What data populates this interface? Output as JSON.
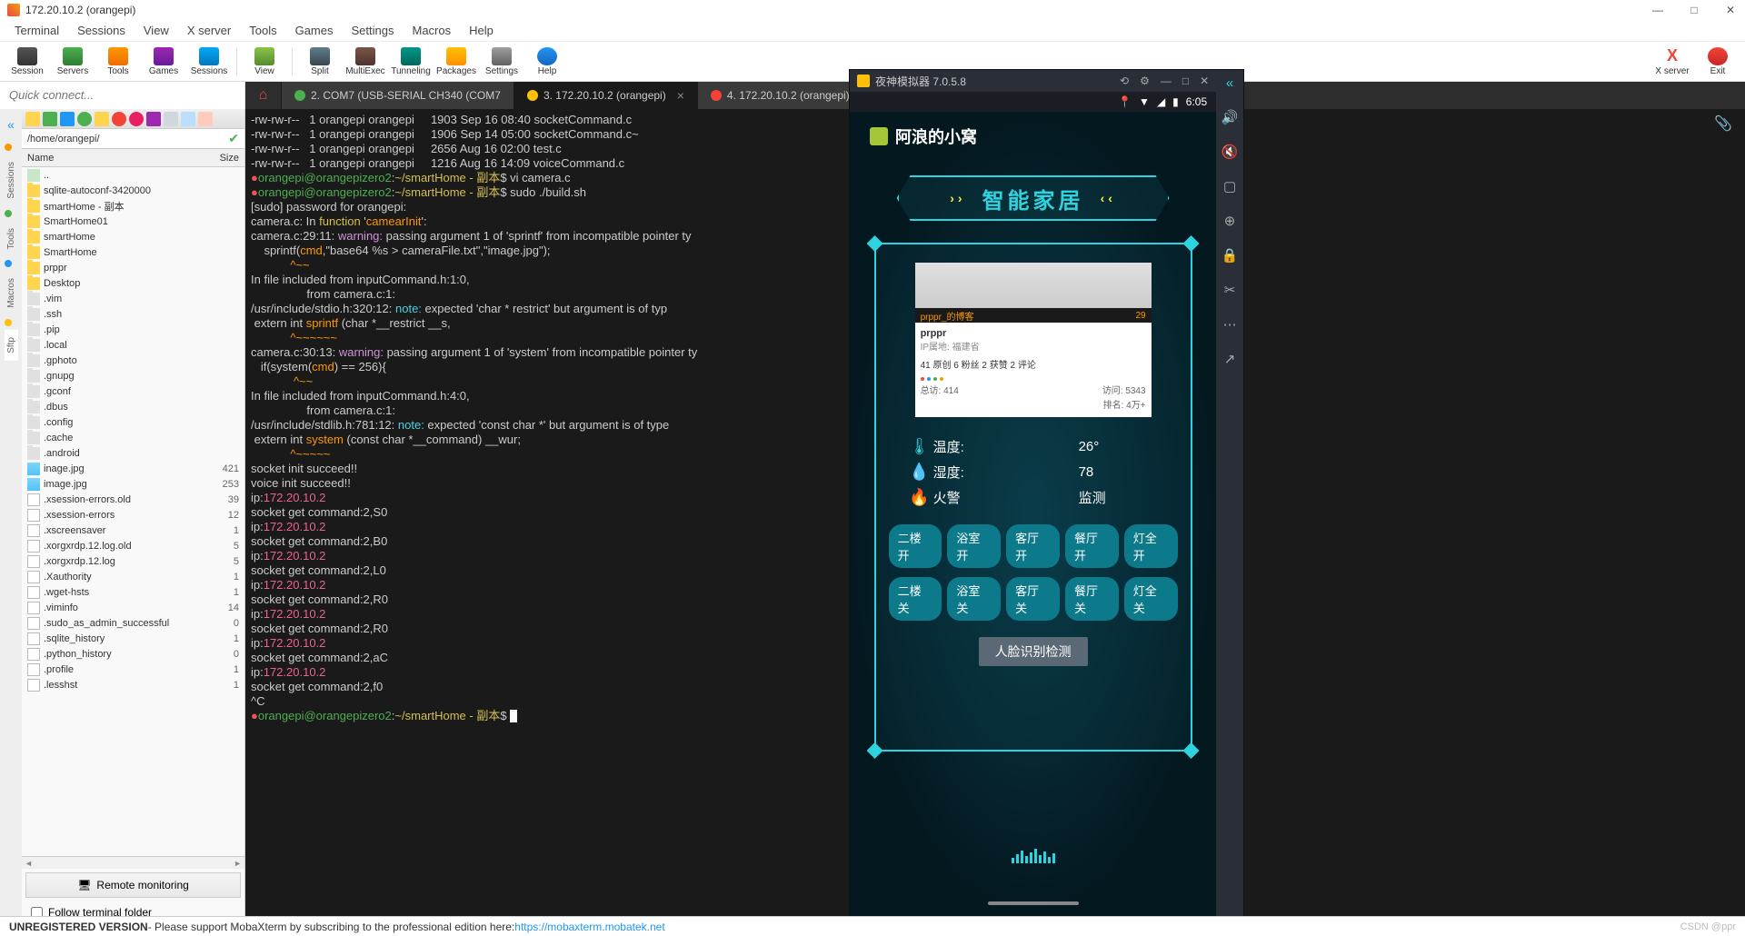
{
  "window": {
    "title": "172.20.10.2 (orangepi)"
  },
  "winControls": {
    "min": "—",
    "max": "□",
    "close": "✕"
  },
  "menu": [
    "Terminal",
    "Sessions",
    "View",
    "X server",
    "Tools",
    "Games",
    "Settings",
    "Macros",
    "Help"
  ],
  "toolbar": [
    {
      "label": "Session",
      "cls": "ti-session"
    },
    {
      "label": "Servers",
      "cls": "ti-servers"
    },
    {
      "label": "Tools",
      "cls": "ti-tools"
    },
    {
      "label": "Games",
      "cls": "ti-games"
    },
    {
      "label": "Sessions",
      "cls": "ti-sessions2"
    },
    {
      "label": "View",
      "cls": "ti-view"
    },
    {
      "label": "Split",
      "cls": "ti-split"
    },
    {
      "label": "MultiExec",
      "cls": "ti-multi"
    },
    {
      "label": "Tunneling",
      "cls": "ti-tunnel"
    },
    {
      "label": "Packages",
      "cls": "ti-pkg"
    },
    {
      "label": "Settings",
      "cls": "ti-settings"
    },
    {
      "label": "Help",
      "cls": "ti-help"
    }
  ],
  "toolbarRight": [
    {
      "label": "X server",
      "cls": "ti-xserver"
    },
    {
      "label": "Exit",
      "cls": "ti-exit"
    }
  ],
  "quickConnect": {
    "placeholder": "Quick connect..."
  },
  "tabs": [
    {
      "label": "2. COM7  (USB-SERIAL CH340 (COM7",
      "color": "#4caf50"
    },
    {
      "label": "3. 172.20.10.2 (orangepi)",
      "color": "#ffc107",
      "active": true,
      "closable": true
    },
    {
      "label": "4. 172.20.10.2 (orangepi)",
      "color": "#f44336"
    }
  ],
  "sideTabs": [
    {
      "label": "Sessions",
      "dot": "#ff9800"
    },
    {
      "label": "Tools",
      "dot": "#4caf50"
    },
    {
      "label": "Macros",
      "dot": "#2196f3"
    },
    {
      "label": "Sftp",
      "dot": "#ffc107",
      "active": true
    }
  ],
  "ftPath": "/home/orangepi/",
  "ftHeader": {
    "name": "Name",
    "size": "Size"
  },
  "ftItems": [
    {
      "name": "..",
      "type": "up",
      "size": ""
    },
    {
      "name": "sqlite-autoconf-3420000",
      "type": "folder",
      "size": ""
    },
    {
      "name": "smartHome - 副本",
      "type": "folder",
      "size": ""
    },
    {
      "name": "SmartHome01",
      "type": "folder",
      "size": ""
    },
    {
      "name": "smartHome",
      "type": "folder",
      "size": ""
    },
    {
      "name": "SmartHome",
      "type": "folder",
      "size": ""
    },
    {
      "name": "prppr",
      "type": "folder",
      "size": ""
    },
    {
      "name": "Desktop",
      "type": "folder",
      "size": ""
    },
    {
      "name": ".vim",
      "type": "hfolder",
      "size": ""
    },
    {
      "name": ".ssh",
      "type": "hfolder",
      "size": ""
    },
    {
      "name": ".pip",
      "type": "hfolder",
      "size": ""
    },
    {
      "name": ".local",
      "type": "hfolder",
      "size": ""
    },
    {
      "name": ".gphoto",
      "type": "hfolder",
      "size": ""
    },
    {
      "name": ".gnupg",
      "type": "hfolder",
      "size": ""
    },
    {
      "name": ".gconf",
      "type": "hfolder",
      "size": ""
    },
    {
      "name": ".dbus",
      "type": "hfolder",
      "size": ""
    },
    {
      "name": ".config",
      "type": "hfolder",
      "size": ""
    },
    {
      "name": ".cache",
      "type": "hfolder",
      "size": ""
    },
    {
      "name": ".android",
      "type": "hfolder",
      "size": ""
    },
    {
      "name": "inage.jpg",
      "type": "img",
      "size": "421"
    },
    {
      "name": "image.jpg",
      "type": "img",
      "size": "253"
    },
    {
      "name": ".xsession-errors.old",
      "type": "file",
      "size": "39"
    },
    {
      "name": ".xsession-errors",
      "type": "file",
      "size": "12"
    },
    {
      "name": ".xscreensaver",
      "type": "file",
      "size": "1"
    },
    {
      "name": ".xorgxrdp.12.log.old",
      "type": "file",
      "size": "5"
    },
    {
      "name": ".xorgxrdp.12.log",
      "type": "file",
      "size": "5"
    },
    {
      "name": ".Xauthority",
      "type": "file",
      "size": "1"
    },
    {
      "name": ".wget-hsts",
      "type": "file",
      "size": "1"
    },
    {
      "name": ".viminfo",
      "type": "file",
      "size": "14"
    },
    {
      "name": ".sudo_as_admin_successful",
      "type": "file",
      "size": "0"
    },
    {
      "name": ".sqlite_history",
      "type": "file",
      "size": "1"
    },
    {
      "name": ".python_history",
      "type": "file",
      "size": "0"
    },
    {
      "name": ".profile",
      "type": "file",
      "size": "1"
    },
    {
      "name": ".lesshst",
      "type": "file",
      "size": "1"
    }
  ],
  "ftRemote": "Remote monitoring",
  "ftFollow": "Follow terminal folder",
  "terminal": {
    "lines": [
      [
        {
          "t": "-rw-rw-r--   1 orangepi orangepi     1903 Sep 16 08:40 socketCommand.c"
        }
      ],
      [
        {
          "t": "-rw-rw-r--   1 orangepi orangepi     1906 Sep 14 05:00 socketCommand.c~"
        }
      ],
      [
        {
          "t": "-rw-rw-r--   1 orangepi orangepi     2656 Aug 16 02:00 test.c"
        }
      ],
      [
        {
          "t": "-rw-rw-r--   1 orangepi orangepi     1216 Aug 16 14:09 voiceCommand.c"
        }
      ],
      [
        {
          "cls": "t-prompt",
          "t": "●"
        },
        {
          "cls": "t-green",
          "t": "orangepi@orangepizero2"
        },
        {
          "t": ":"
        },
        {
          "cls": "t-yellow",
          "t": "~/smartHome - 副本"
        },
        {
          "t": "$ vi camera.c"
        }
      ],
      [
        {
          "cls": "t-prompt",
          "t": "●"
        },
        {
          "cls": "t-green",
          "t": "orangepi@orangepizero2"
        },
        {
          "t": ":"
        },
        {
          "cls": "t-yellow",
          "t": "~/smartHome - 副本"
        },
        {
          "t": "$ sudo ./build.sh"
        }
      ],
      [
        {
          "t": "[sudo] password for orangepi:"
        }
      ],
      [
        {
          "t": "camera.c: In "
        },
        {
          "cls": "t-yellow",
          "t": "function"
        },
        {
          "t": " '"
        },
        {
          "cls": "t-orange",
          "t": "camearInit"
        },
        {
          "t": "':"
        }
      ],
      [
        {
          "t": "camera.c:29:11: "
        },
        {
          "cls": "t-purple",
          "t": "warning:"
        },
        {
          "t": " passing argument 1 of 'sprintf' from incompatible pointer ty"
        }
      ],
      [
        {
          "t": "    sprintf("
        },
        {
          "cls": "t-orange",
          "t": "cmd"
        },
        {
          "t": ",\"base64 %s > cameraFile.txt\",\"image.jpg\");"
        }
      ],
      [
        {
          "cls": "t-orange",
          "t": "            ^~~"
        }
      ],
      [
        {
          "t": "In file included from inputCommand.h:1:0,"
        }
      ],
      [
        {
          "t": "                 from camera.c:1:"
        }
      ],
      [
        {
          "t": "/usr/include/stdio.h:320:12: "
        },
        {
          "cls": "t-cyan",
          "t": "note:"
        },
        {
          "t": " expected 'char * restrict' but argument is of typ"
        }
      ],
      [
        {
          "t": " extern int "
        },
        {
          "cls": "t-orange",
          "t": "sprintf"
        },
        {
          "t": " (char *__restrict __s,"
        }
      ],
      [
        {
          "cls": "t-orange",
          "t": "            ^~~~~~~"
        }
      ],
      [
        {
          "t": "camera.c:30:13: "
        },
        {
          "cls": "t-purple",
          "t": "warning:"
        },
        {
          "t": " passing argument 1 of 'system' from incompatible pointer ty"
        }
      ],
      [
        {
          "t": "   if(system("
        },
        {
          "cls": "t-orange",
          "t": "cmd"
        },
        {
          "t": ") == 256){"
        }
      ],
      [
        {
          "cls": "t-orange",
          "t": "             ^~~"
        }
      ],
      [
        {
          "t": "In file included from inputCommand.h:4:0,"
        }
      ],
      [
        {
          "t": "                 from camera.c:1:"
        }
      ],
      [
        {
          "t": "/usr/include/stdlib.h:781:12: "
        },
        {
          "cls": "t-cyan",
          "t": "note:"
        },
        {
          "t": " expected 'const char *' but argument is of type "
        }
      ],
      [
        {
          "t": " extern int "
        },
        {
          "cls": "t-orange",
          "t": "system"
        },
        {
          "t": " (const char *__command) __wur;"
        }
      ],
      [
        {
          "cls": "t-orange",
          "t": "            ^~~~~~"
        }
      ],
      [
        {
          "t": "socket init succeed!!"
        }
      ],
      [
        {
          "t": "voice init succeed!!"
        }
      ],
      [
        {
          "t": "ip:"
        },
        {
          "cls": "t-pink",
          "t": "172.20.10.2"
        }
      ],
      [
        {
          "t": "socket get command:2,S0"
        }
      ],
      [
        {
          "t": "ip:"
        },
        {
          "cls": "t-pink",
          "t": "172.20.10.2"
        }
      ],
      [
        {
          "t": "socket get command:2,B0"
        }
      ],
      [
        {
          "t": "ip:"
        },
        {
          "cls": "t-pink",
          "t": "172.20.10.2"
        }
      ],
      [
        {
          "t": "socket get command:2,L0"
        }
      ],
      [
        {
          "t": "ip:"
        },
        {
          "cls": "t-pink",
          "t": "172.20.10.2"
        }
      ],
      [
        {
          "t": "socket get command:2,R0"
        }
      ],
      [
        {
          "t": "ip:"
        },
        {
          "cls": "t-pink",
          "t": "172.20.10.2"
        }
      ],
      [
        {
          "t": "socket get command:2,R0"
        }
      ],
      [
        {
          "t": "ip:"
        },
        {
          "cls": "t-pink",
          "t": "172.20.10.2"
        }
      ],
      [
        {
          "t": "socket get command:2,aC"
        }
      ],
      [
        {
          "t": "ip:"
        },
        {
          "cls": "t-pink",
          "t": "172.20.10.2"
        }
      ],
      [
        {
          "t": "socket get command:2,f0"
        }
      ],
      [
        {
          "t": "^C"
        }
      ],
      [
        {
          "cls": "t-prompt",
          "t": "●"
        },
        {
          "cls": "t-green",
          "t": "orangepi@orangepizero2"
        },
        {
          "t": ":"
        },
        {
          "cls": "t-yellow",
          "t": "~/smartHome - 副本"
        },
        {
          "t": "$ "
        },
        {
          "cursor": true
        }
      ]
    ]
  },
  "nox": {
    "title": "夜神模拟器 7.0.5.8",
    "statusTime": "6:05",
    "appTitle": "阿浪的小窝",
    "banner": "智能家居",
    "card": {
      "barLeft": "prppr_的博客",
      "barRight": "29",
      "name": "prppr",
      "loc": "IP属地: 福建省",
      "stats": "41 原创  6 粉丝  2 获赞  2 评论",
      "bl_label": "总访:",
      "bl_val": "414",
      "br_label1": "访问:",
      "br_val1": "5343",
      "br_label2": "排名:",
      "br_val2": "4万+"
    },
    "stats": [
      {
        "icon": "🌡",
        "label": "温度:",
        "val": "26°"
      },
      {
        "icon": "💧",
        "label": "湿度:",
        "val": "78"
      },
      {
        "icon": "🔥",
        "label": "火警",
        "val": "监测"
      }
    ],
    "row1": [
      "二楼开",
      "浴室开",
      "客厅开",
      "餐厅开",
      "灯全开"
    ],
    "row2": [
      "二楼关",
      "浴室关",
      "客厅关",
      "餐厅关",
      "灯全关"
    ],
    "bigBtn": "人脸识别检测",
    "sideIcons": [
      "«",
      "🔊",
      "🔇",
      "▢",
      "⊕",
      "🔒",
      "✂",
      "⋯",
      "↗"
    ]
  },
  "status": {
    "unreg": "UNREGISTERED VERSION",
    "msg": "  -  Please support MobaXterm by subscribing to the professional edition here:  ",
    "link": "https://mobaxterm.mobatek.net",
    "watermark": "CSDN @ppr"
  }
}
